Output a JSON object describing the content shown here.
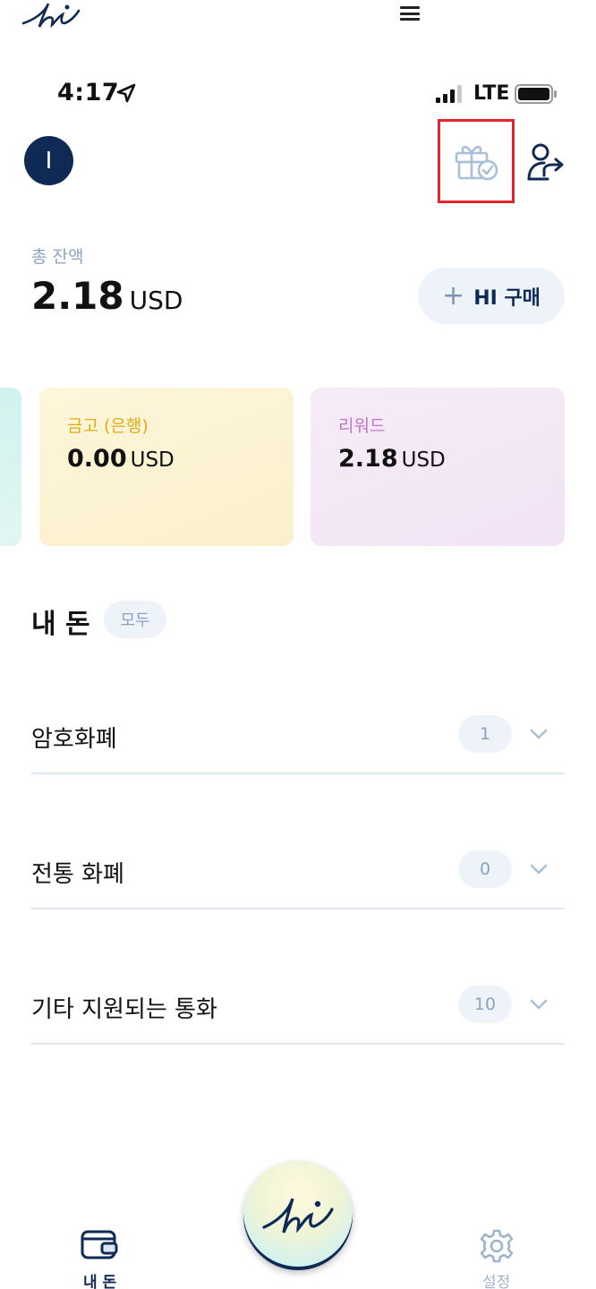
{
  "top_bar": {
    "logo_icon": "hi-logo-icon",
    "menu_icon": "hamburger-menu-icon"
  },
  "status_bar": {
    "time": "4:17",
    "network": "LTE",
    "location_icon": "location-arrow-icon",
    "signal_icon": "signal-bars-icon",
    "battery_icon": "battery-icon"
  },
  "header": {
    "avatar_initial": "I",
    "gift_icon": "gift-check-icon",
    "highlight_color": "#e3262d",
    "share_icon": "user-share-icon"
  },
  "balance": {
    "label": "총 잔액",
    "amount": "2.18",
    "unit": "USD",
    "buy_button_plus": "+",
    "buy_button_label": "HI 구매"
  },
  "cards": [
    {
      "title": "금고 (은행)",
      "amount": "0.00",
      "unit": "USD",
      "color": "#e1aa18"
    },
    {
      "title": "리워드",
      "amount": "2.18",
      "unit": "USD",
      "color": "#c174c8"
    }
  ],
  "my_money": {
    "title": "내 돈",
    "filter_chip": "모두",
    "rows": [
      {
        "label": "암호화폐",
        "count": "1"
      },
      {
        "label": "전통 화폐",
        "count": "0"
      },
      {
        "label": "기타 지원되는 통화",
        "count": "10"
      }
    ]
  },
  "bottom_nav": {
    "wallet_label": "내 돈",
    "settings_label": "설정",
    "accent": "#0f2a55",
    "inactive": "#9fb4cc"
  }
}
